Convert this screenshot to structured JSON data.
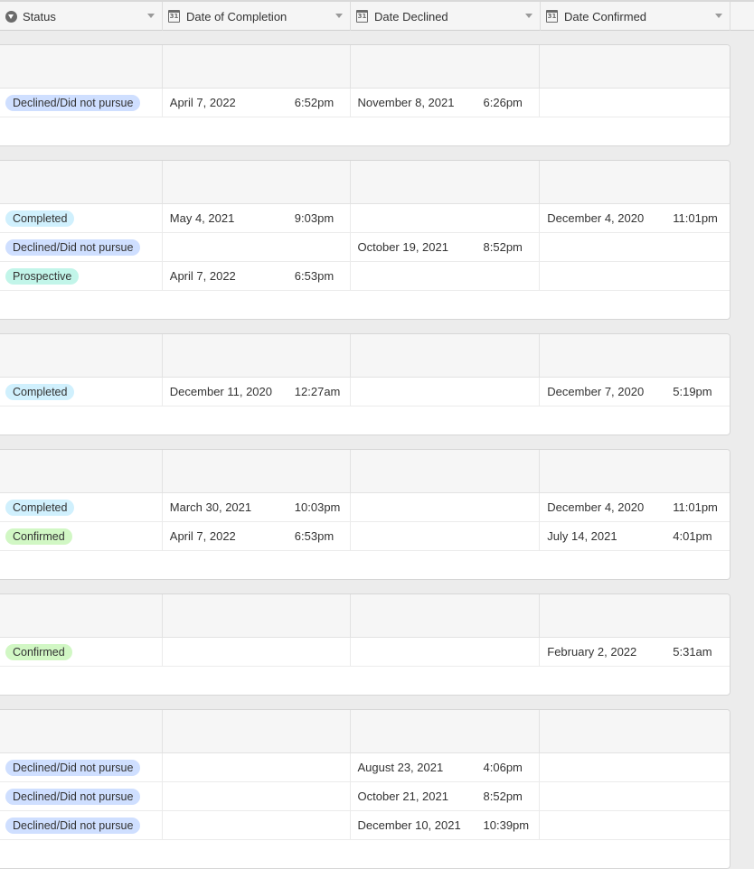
{
  "columns": [
    {
      "label": "Status",
      "icon": "status-icon"
    },
    {
      "label": "Date of Completion",
      "icon": "calendar-icon",
      "icon_text": "31"
    },
    {
      "label": "Date Declined",
      "icon": "calendar-icon",
      "icon_text": "31"
    },
    {
      "label": "Date Confirmed",
      "icon": "calendar-icon",
      "icon_text": "31"
    }
  ],
  "status_colors": {
    "Declined/Did not pursue": "#cfdfff",
    "Completed": "#d0f0fd",
    "Prospective": "#c2f5e9",
    "Confirmed": "#d1f7c4"
  },
  "groups": [
    {
      "rows": [
        {
          "status": "Declined/Did not pursue",
          "completion_date": "April 7, 2022",
          "completion_time": "6:52pm",
          "declined_date": "November 8, 2021",
          "declined_time": "6:26pm",
          "confirmed_date": "",
          "confirmed_time": ""
        }
      ]
    },
    {
      "rows": [
        {
          "status": "Completed",
          "completion_date": "May 4, 2021",
          "completion_time": "9:03pm",
          "declined_date": "",
          "declined_time": "",
          "confirmed_date": "December 4, 2020",
          "confirmed_time": "11:01pm"
        },
        {
          "status": "Declined/Did not pursue",
          "completion_date": "",
          "completion_time": "",
          "declined_date": "October 19, 2021",
          "declined_time": "8:52pm",
          "confirmed_date": "",
          "confirmed_time": ""
        },
        {
          "status": "Prospective",
          "completion_date": "April 7, 2022",
          "completion_time": "6:53pm",
          "declined_date": "",
          "declined_time": "",
          "confirmed_date": "",
          "confirmed_time": ""
        }
      ]
    },
    {
      "rows": [
        {
          "status": "Completed",
          "completion_date": "December 11, 2020",
          "completion_time": "12:27am",
          "declined_date": "",
          "declined_time": "",
          "confirmed_date": "December 7, 2020",
          "confirmed_time": "5:19pm"
        }
      ]
    },
    {
      "rows": [
        {
          "status": "Completed",
          "completion_date": "March 30, 2021",
          "completion_time": "10:03pm",
          "declined_date": "",
          "declined_time": "",
          "confirmed_date": "December 4, 2020",
          "confirmed_time": "11:01pm"
        },
        {
          "status": "Confirmed",
          "completion_date": "April 7, 2022",
          "completion_time": "6:53pm",
          "declined_date": "",
          "declined_time": "",
          "confirmed_date": "July 14, 2021",
          "confirmed_time": "4:01pm"
        }
      ]
    },
    {
      "rows": [
        {
          "status": "Confirmed",
          "completion_date": "",
          "completion_time": "",
          "declined_date": "",
          "declined_time": "",
          "confirmed_date": "February 2, 2022",
          "confirmed_time": "5:31am"
        }
      ]
    },
    {
      "rows": [
        {
          "status": "Declined/Did not pursue",
          "completion_date": "",
          "completion_time": "",
          "declined_date": "August 23, 2021",
          "declined_time": "4:06pm",
          "confirmed_date": "",
          "confirmed_time": ""
        },
        {
          "status": "Declined/Did not pursue",
          "completion_date": "",
          "completion_time": "",
          "declined_date": "October 21, 2021",
          "declined_time": "8:52pm",
          "confirmed_date": "",
          "confirmed_time": ""
        },
        {
          "status": "Declined/Did not pursue",
          "completion_date": "",
          "completion_time": "",
          "declined_date": "December 10, 2021",
          "declined_time": "10:39pm",
          "confirmed_date": "",
          "confirmed_time": ""
        }
      ]
    }
  ]
}
